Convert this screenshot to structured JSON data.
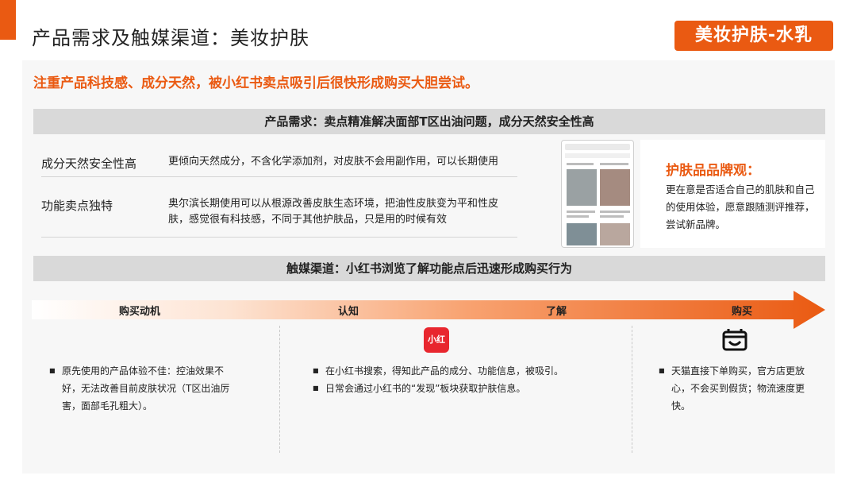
{
  "header": {
    "title": "产品需求及触媒渠道：美妆护肤",
    "tag": "美妆护肤-水乳",
    "subtitle": "注重产品科技感、成分天然，被小红书卖点吸引后很快形成购买大胆尝试。"
  },
  "needs": {
    "bar_label": "产品需求：卖点精准解决面部T区出油问题，成分天然安全性高",
    "rows": [
      {
        "label": "成分天然安全性高",
        "text": "更倾向天然成分，不含化学添加剂，对皮肤不会用副作用，可以长期使用"
      },
      {
        "label": "功能卖点独特",
        "text": "奥尔滨长期使用可以从根源改善皮肤生态环境，把油性皮肤变为平和性皮肤，感觉很有科技感，不同于其他护肤品，只是用的时候有效"
      }
    ]
  },
  "brand_view": {
    "title": "护肤品品牌观：",
    "text": "更在意是否适合自己的肌肤和自己的使用体验，愿意跟随测评推荐，尝试新品牌。"
  },
  "channel": {
    "bar_label": "触媒渠道：小红书浏览了解功能点后迅速形成购买行为",
    "stages": [
      "购买动机",
      "认知",
      "了解",
      "购买"
    ],
    "accent_color": "#ea5a12",
    "xhs_logo_text": "小红书",
    "columns": [
      {
        "items": [
          "原先使用的产品体验不佳：控油效果不好，无法改善目前皮肤状况（T区出油厉害，面部毛孔粗大）。"
        ]
      },
      {
        "items": [
          "在小红书搜索，得知此产品的成分、功能信息，被吸引。",
          "日常会通过小红书的“发现”板块获取护肤信息。"
        ]
      },
      {
        "items": [
          "天猫直接下单购买，官方店更放心，不会买到假货；物流速度更快。"
        ]
      }
    ]
  }
}
